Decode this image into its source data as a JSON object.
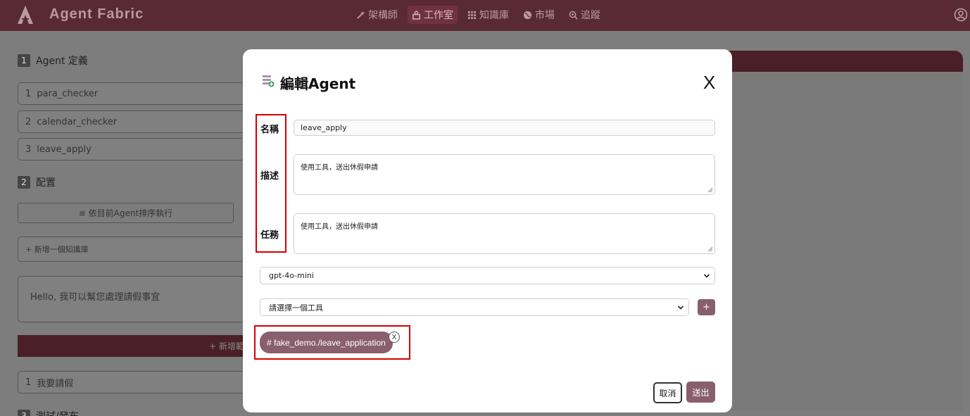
{
  "app": {
    "title": "Agent Fabric",
    "nav": [
      {
        "label": "架構師",
        "icon": "magic-wand-icon"
      },
      {
        "label": "工作室",
        "icon": "studio-icon",
        "active": true
      },
      {
        "label": "知識庫",
        "icon": "grid-icon"
      },
      {
        "label": "市場",
        "icon": "globe-icon"
      },
      {
        "label": "追蹤",
        "icon": "search-zoom-icon"
      }
    ]
  },
  "background": {
    "section1": {
      "num": "1",
      "title": "Agent 定義"
    },
    "agents": [
      {
        "num": "1",
        "name": "para_checker"
      },
      {
        "num": "2",
        "name": "calendar_checker"
      },
      {
        "num": "3",
        "name": "leave_apply"
      }
    ],
    "section2": {
      "num": "2",
      "title": "配置"
    },
    "run_order_label": "≡ 依目前Agent排序執行",
    "add_kb_label": "+ 新增一個知識庫",
    "greeting": "Hello, 我可以幫您處理請假事宜",
    "add_bar_label": "+ 新增範",
    "examples": [
      {
        "num": "1",
        "text": "我要請假"
      }
    ],
    "section3": {
      "num": "3",
      "title": "測試/發布"
    }
  },
  "modal": {
    "title": "編輯Agent",
    "close_label": "X",
    "labels": {
      "name": "名稱",
      "description": "描述",
      "task": "任務"
    },
    "name_value": "leave_apply",
    "description_value": "使用工具，送出休假申請",
    "task_value": "使用工具，送出休假申請",
    "model_value": "gpt-4o-mini",
    "tool_placeholder": "請選擇一個工具",
    "add_tool_label": "+",
    "tools": [
      {
        "label": "# fake_demo./leave_application",
        "remove_label": "X"
      }
    ],
    "cancel_label": "取消",
    "submit_label": "送出"
  },
  "colors": {
    "nav_bg": "#5a2a34",
    "accent": "#8a5f6d",
    "highlight": "#d40000"
  }
}
